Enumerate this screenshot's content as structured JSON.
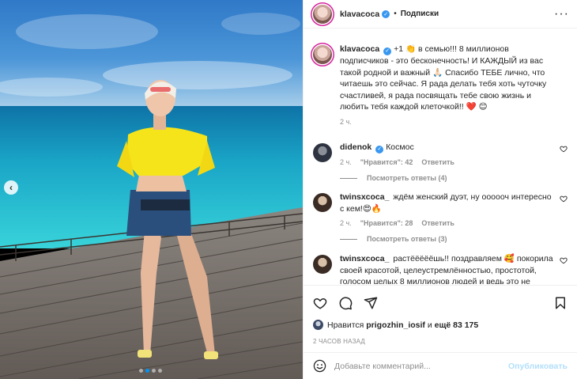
{
  "header": {
    "username": "klavacoca",
    "follow_label": "Подписки",
    "bullet": "•",
    "more_icon": "more-dots-icon"
  },
  "caption": {
    "username": "klavacoca",
    "text": "+1 👏 в семью!!! 8 миллионов подписчиков - это бесконечность! И КАЖДЫЙ из вас такой родной и важный 🙏🏻 Спасибо ТЕБЕ лично, что читаешь это сейчас. Я рада делать тебя хоть чуточку счастливей, я рада посвящать тебе свою жизнь и любить тебя каждой клеточкой!! ❤️ 😊",
    "time": "2 ч."
  },
  "comments": [
    {
      "username": "didenok",
      "text": "Космос",
      "time": "2 ч.",
      "likes": "\"Нравится\": 42",
      "reply": "Ответить",
      "replies": "Посмотреть ответы (4)"
    },
    {
      "username": "twinsxcoca_",
      "text": "ждём женский дуэт, ну оооооч интересно с кем!😍🔥",
      "time": "2 ч.",
      "likes": "\"Нравится\": 28",
      "reply": "Ответить",
      "replies": "Посмотреть ответы (3)"
    },
    {
      "username": "twinsxcoca_",
      "text": "растёёёёёшь!! поздравляем 🥰 покорила своей красотой, целеустремлённостью, простотой, голосом целых 8 миллионов людей и ведь это не предел🔥, как бы банально это не звучало, но дальше",
      "time": "",
      "likes": "",
      "reply": "",
      "replies": ""
    }
  ],
  "likes": {
    "prefix": "Нравится",
    "user": "prigozhin_iosif",
    "conjunction": "и",
    "rest": "ещё 83 175"
  },
  "posted_ago": "2 ЧАСОВ НАЗАД",
  "add_comment": {
    "placeholder": "Добавьте комментарий...",
    "publish_label": "Опубликовать"
  },
  "colors": {
    "verified": "#3897f0",
    "link": "#0095f6",
    "publish_disabled": "#b2dffc",
    "muted": "#8e8e8e"
  },
  "carousel": {
    "prev_label": "‹",
    "current_slide": 1,
    "slide_count": 4
  }
}
